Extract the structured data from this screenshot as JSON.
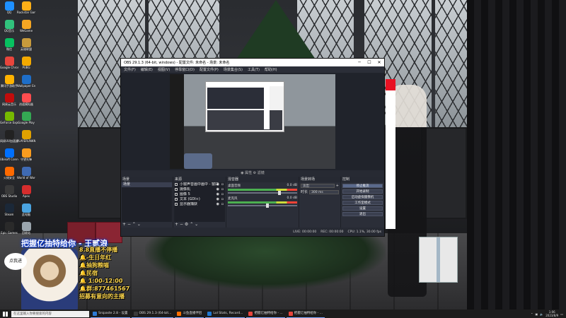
{
  "desktop": {
    "icons": [
      {
        "label": "QQ",
        "color": "#1e90ff"
      },
      {
        "label": "QQ音乐",
        "color": "#31c27c"
      },
      {
        "label": "微信",
        "color": "#07c160"
      },
      {
        "label": "Google Chrome",
        "color": "#e8453c"
      },
      {
        "label": "腾讯手游助手",
        "color": "#ffb300"
      },
      {
        "label": "网易云音乐",
        "color": "#c20c0c"
      },
      {
        "label": "GeForce Experience",
        "color": "#76b900"
      },
      {
        "label": "网易UU加速器",
        "color": "#222222"
      },
      {
        "label": "Ubisoft Connect",
        "color": "#0070ff"
      },
      {
        "label": "火绒安全",
        "color": "#ff6a00"
      },
      {
        "label": "OBS Studio",
        "color": "#3a3a3a"
      },
      {
        "label": "Steam",
        "color": "#1b2838"
      },
      {
        "label": "Epic Games",
        "color": "#2a2a2a"
      },
      {
        "label": "Rockstar Games",
        "color": "#fcaf17"
      },
      {
        "label": "WeGame",
        "color": "#f5a623"
      },
      {
        "label": "英雄联盟",
        "color": "#c89b3c"
      },
      {
        "label": "PUBG",
        "color": "#f2a900"
      },
      {
        "label": "Wallpaper Engine",
        "color": "#1e6ec8"
      },
      {
        "label": "逍遥模拟器",
        "color": "#ff4d4f"
      },
      {
        "label": "Google Play",
        "color": "#34a853"
      },
      {
        "label": "PLAYERUNKNOWN'S BATTLEGROUNDS",
        "color": "#e0a100"
      },
      {
        "label": "守望先锋",
        "color": "#fa9c1e"
      },
      {
        "label": "World of Warcraft",
        "color": "#3f6ab3"
      },
      {
        "label": "Apex",
        "color": "#d62d2d"
      },
      {
        "label": "此电脑",
        "color": "#4aa3df"
      },
      {
        "label": "回收站",
        "color": "#9aa5ad"
      }
    ]
  },
  "obs": {
    "title": "OBS 29.1.3 (64-bit, windows) - 配置文件: 未命名 - 场景: 未命名",
    "menu": [
      "文件(F)",
      "编辑(E)",
      "视图(V)",
      "停靠窗口(D)",
      "配置文件(P)",
      "场景集合(S)",
      "工具(T)",
      "帮助(H)"
    ],
    "preview_toolbar": "◉ 属性 ⚙ 滤镜",
    "docks": {
      "scenes": {
        "title": "场景",
        "items": [
          "场景"
        ]
      },
      "sources": {
        "title": "来源",
        "items": [
          "小窗声音画中画中 - 窗口",
          "摄像机",
          "图像 5",
          "文本 (GDI+)",
          "显示器捕获"
        ]
      },
      "mixer": {
        "title": "混音器",
        "channels": [
          {
            "name": "桌面音频",
            "db": "0.0 dB",
            "level": 0.72
          },
          {
            "name": "麦克风",
            "db": "0.0 dB",
            "level": 0.55
          }
        ]
      },
      "transitions": {
        "title": "场景转场",
        "type": "淡出",
        "duration_label": "时长",
        "duration": "300 ms"
      },
      "controls": {
        "title": "控制",
        "buttons": [
          "停止推流",
          "开始录制",
          "启动虚拟摄像机",
          "工作室模式",
          "设置",
          "退出"
        ]
      }
    },
    "status": [
      "LIVE: 00:00:00",
      "REC: 00:00:00",
      "CPU: 1.1%, 30.00 fps"
    ]
  },
  "overlay": {
    "title": "把握亿抽特给你 - 王贰浪",
    "badge": "点我进",
    "chat": [
      {
        "text": "8.8直播不停播",
        "color": "#ffd84d"
      },
      {
        "text": "🔔-生日年红",
        "color": "#ffd84d"
      },
      {
        "text": "🔔抽狗粮喵",
        "color": "#ffd84d"
      },
      {
        "text": "🔔民宿",
        "color": "#ffd84d"
      },
      {
        "text": "🔔 1:00-12:00",
        "color": "#ffd84d"
      },
      {
        "text": "🔔群:877461567",
        "color": "#ffd84d"
      },
      {
        "text": "招募有意向的主播",
        "color": "#ffd84d"
      }
    ]
  },
  "taskbar": {
    "search_placeholder": "在这里输入你要搜索的内容",
    "tasks": [
      {
        "label": "Snipaste 2.8 - 设置",
        "color": "#2d7bd6"
      },
      {
        "label": "OBS 29.1.3 (64-bit...",
        "color": "#3a3a3a"
      },
      {
        "label": "斗鱼直播伴侣",
        "color": "#ff6f00"
      },
      {
        "label": "Lol Stats, Record...",
        "color": "#1f78d1"
      },
      {
        "label": "把握亿抽特给你 - ...",
        "color": "#e8453c"
      },
      {
        "label": "把握亿抽特给你 - ...",
        "color": "#e8453c"
      }
    ],
    "time": "1:06",
    "date": "2023/8/9"
  }
}
